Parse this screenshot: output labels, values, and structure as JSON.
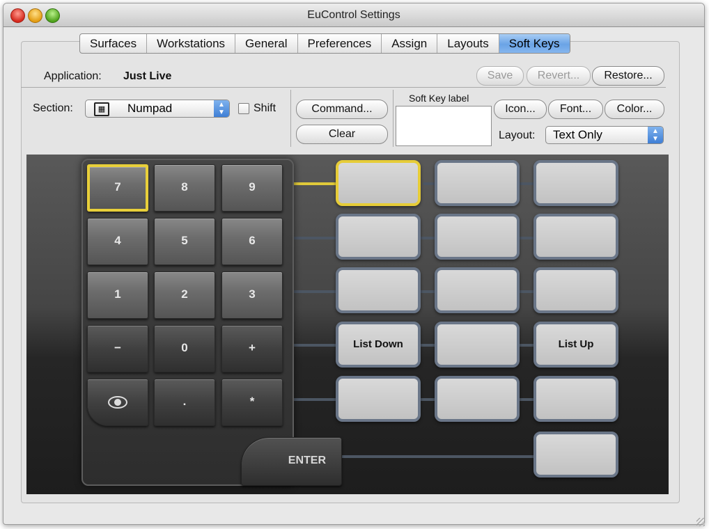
{
  "window": {
    "title": "EuControl Settings"
  },
  "tabs": [
    {
      "label": "Surfaces",
      "active": false
    },
    {
      "label": "Workstations",
      "active": false
    },
    {
      "label": "General",
      "active": false
    },
    {
      "label": "Preferences",
      "active": false
    },
    {
      "label": "Assign",
      "active": false
    },
    {
      "label": "Layouts",
      "active": false
    },
    {
      "label": "Soft Keys",
      "active": true
    }
  ],
  "application": {
    "label": "Application:",
    "value": "Just Live"
  },
  "actions": {
    "save": "Save",
    "revert": "Revert...",
    "restore": "Restore..."
  },
  "section": {
    "label": "Section:",
    "value": "Numpad",
    "shift_label": "Shift",
    "shift_checked": false
  },
  "command": {
    "command_label": "Command...",
    "clear_label": "Clear"
  },
  "soft_key_label": {
    "label": "Soft Key label",
    "value": ""
  },
  "appearance": {
    "icon": "Icon...",
    "font": "Font...",
    "color": "Color...",
    "layout_label": "Layout:",
    "layout_value": "Text Only"
  },
  "numpad": {
    "keys": [
      "7",
      "8",
      "9",
      "4",
      "5",
      "6",
      "1",
      "2",
      "3",
      "−",
      "0",
      "+",
      "eye-icon",
      ".",
      "*"
    ],
    "enter": "ENTER",
    "selected_key": "7"
  },
  "softkeys": {
    "labels": [
      "",
      "",
      "",
      "",
      "",
      "",
      "",
      "",
      "",
      "List Down",
      "",
      "List Up",
      "",
      "",
      "",
      ""
    ],
    "selected_index": 0
  },
  "colors": {
    "selection": "#e6cc38",
    "tab_active": "#6aa3e6"
  }
}
